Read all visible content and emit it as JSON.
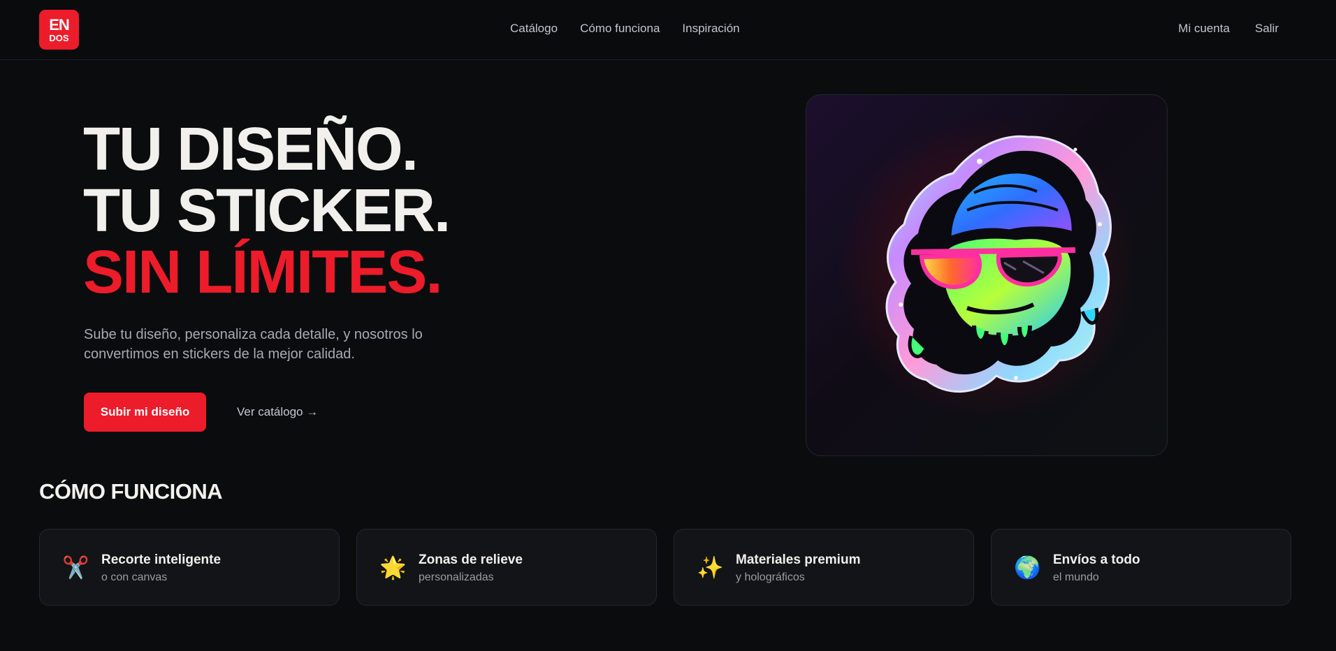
{
  "brand": {
    "logo_line1": "EN",
    "logo_line2": "DOS",
    "accent": "#ed1c2a"
  },
  "nav": {
    "items": [
      "Catálogo",
      "Cómo funciona",
      "Inspiración"
    ],
    "account": "Mi cuenta",
    "logout": "Salir"
  },
  "hero": {
    "line1": "TU DISEÑO.",
    "line2": "TU STICKER.",
    "line3": "SIN LÍMITES.",
    "subtitle": "Sube tu diseño, personaliza cada detalle, y nosotros lo convertimos en stickers de la mejor calidad.",
    "cta_primary": "Subir mi diseño",
    "cta_secondary": "Ver catálogo →"
  },
  "preview": {
    "icon": "holographic-sticker-illustration"
  },
  "how_it_works": {
    "title": "CÓMO FUNCIONA",
    "features": [
      {
        "icon": "scissors-icon",
        "glyph": "✂️",
        "title": "Recorte inteligente",
        "subtitle": "o con canvas"
      },
      {
        "icon": "star-icon",
        "glyph": "🌟",
        "title": "Zonas de relieve",
        "subtitle": "personalizadas"
      },
      {
        "icon": "sparkles-icon",
        "glyph": "✨",
        "title": "Materiales premium",
        "subtitle": "y holográficos"
      },
      {
        "icon": "globe-icon",
        "glyph": "🌍",
        "title": "Envíos a todo",
        "subtitle": "el mundo"
      }
    ]
  }
}
